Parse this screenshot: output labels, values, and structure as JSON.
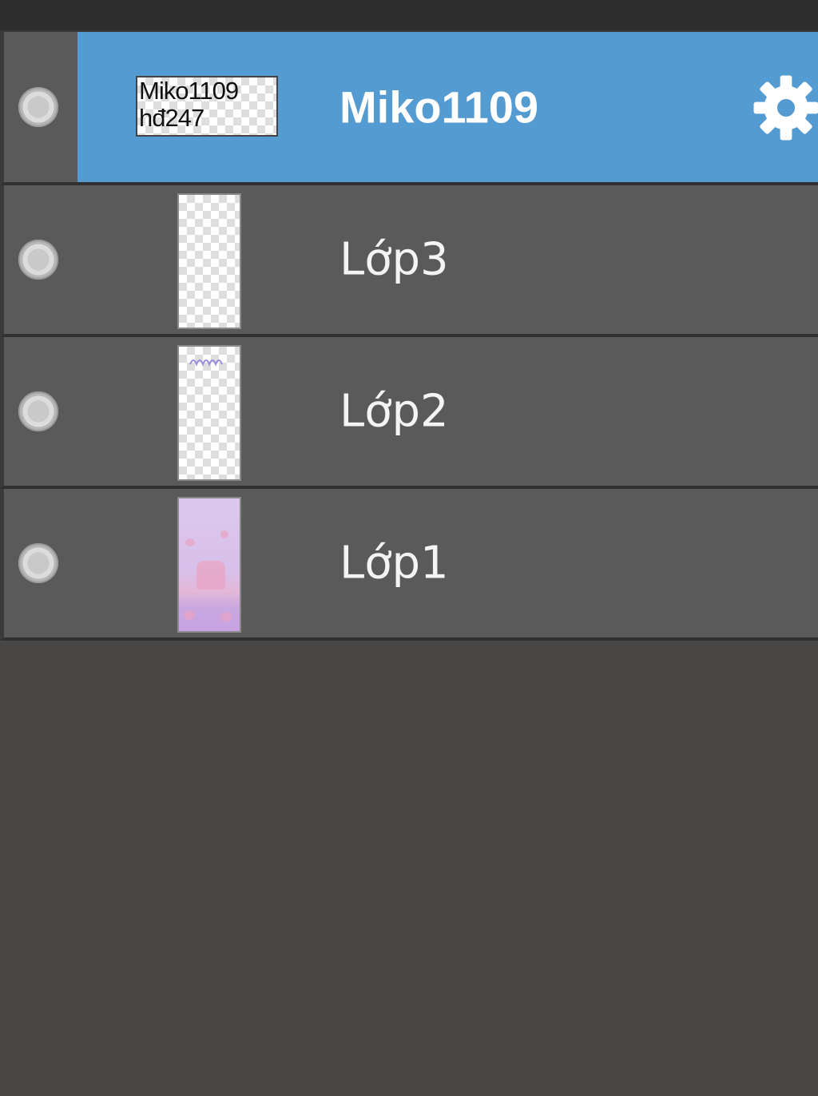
{
  "layers": {
    "items": [
      {
        "name": "Miko1109",
        "selected": true,
        "visible": true,
        "thumbnail_text": "Miko1109\nhđ247",
        "settings_icon": "gear-icon"
      },
      {
        "name": "Lớp3",
        "selected": false,
        "visible": true
      },
      {
        "name": "Lớp2",
        "selected": false,
        "visible": true
      },
      {
        "name": "Lớp1",
        "selected": false,
        "visible": true
      }
    ]
  },
  "colors": {
    "selected_row": "#549bd2",
    "row": "#5a5a5a",
    "panel_bg": "#484746",
    "text": "#f4f4f4"
  },
  "icons": {
    "visibility": "visibility-toggle-icon",
    "settings": "gear-icon"
  }
}
